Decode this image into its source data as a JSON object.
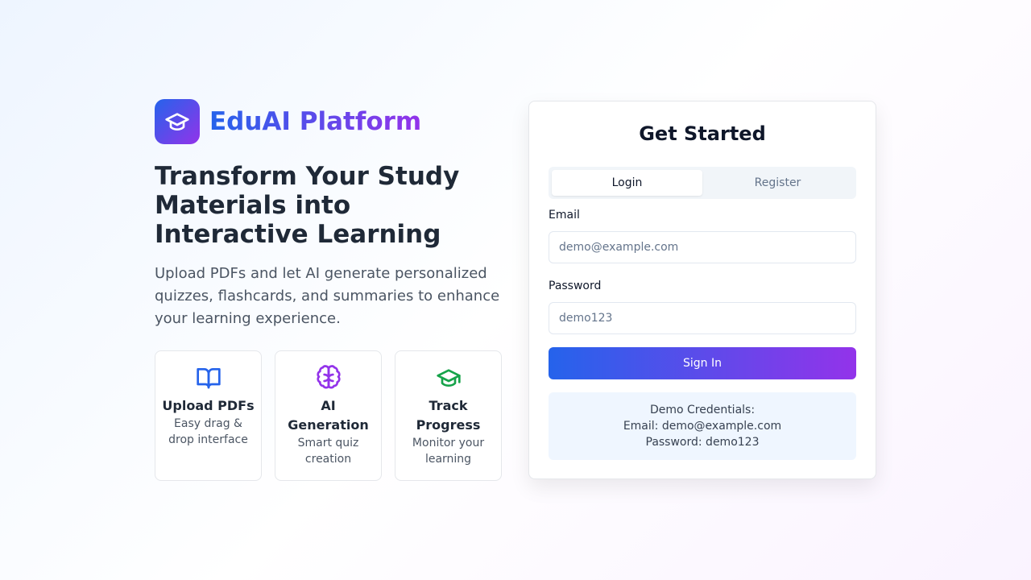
{
  "brand": {
    "name": "EduAI Platform",
    "logo_icon": "graduation-cap-icon"
  },
  "hero": {
    "headline": "Transform Your Study Materials into Interactive Learning",
    "subtitle": "Upload PDFs and let AI generate personalized quizzes, flashcards, and summaries to enhance your learning experience."
  },
  "features": [
    {
      "icon": "book-open-icon",
      "title": "Upload PDFs",
      "desc": "Easy drag & drop interface",
      "color": "#2563eb"
    },
    {
      "icon": "brain-icon",
      "title": "AI Generation",
      "desc": "Smart quiz creation",
      "color": "#9333ea"
    },
    {
      "icon": "graduation-cap-icon",
      "title": "Track Progress",
      "desc": "Monitor your learning",
      "color": "#16a34a"
    }
  ],
  "auth": {
    "title": "Get Started",
    "tabs": [
      {
        "label": "Login",
        "active": true
      },
      {
        "label": "Register",
        "active": false
      }
    ],
    "email_label": "Email",
    "email_placeholder": "demo@example.com",
    "email_value": "",
    "password_label": "Password",
    "password_placeholder": "demo123",
    "password_value": "",
    "submit_label": "Sign In",
    "demo": {
      "heading": "Demo Credentials:",
      "email_line": "Email: demo@example.com",
      "password_line": "Password: demo123"
    }
  },
  "colors": {
    "accent_start": "#2563eb",
    "accent_end": "#9333ea",
    "green": "#16a34a"
  }
}
